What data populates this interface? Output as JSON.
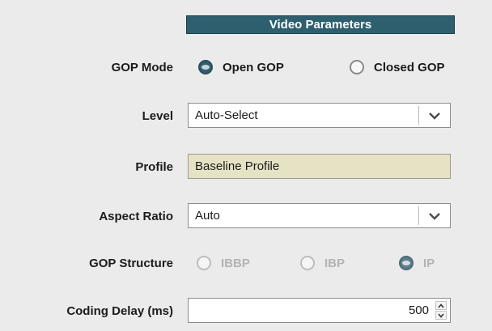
{
  "header": {
    "title": "Video Parameters"
  },
  "gop_mode": {
    "label": "GOP Mode",
    "options": [
      {
        "label": "Open GOP",
        "checked": true
      },
      {
        "label": "Closed GOP",
        "checked": false
      }
    ]
  },
  "level": {
    "label": "Level",
    "value": "Auto-Select",
    "icon": "chevron-down-icon"
  },
  "profile": {
    "label": "Profile",
    "value": "Baseline Profile"
  },
  "aspect_ratio": {
    "label": "Aspect Ratio",
    "value": "Auto",
    "icon": "chevron-down-icon"
  },
  "gop_structure": {
    "label": "GOP Structure",
    "disabled": true,
    "options": [
      {
        "label": "IBBP",
        "checked": false
      },
      {
        "label": "IBP",
        "checked": false
      },
      {
        "label": "IP",
        "checked": true
      }
    ]
  },
  "coding_delay": {
    "label": "Coding Delay (ms)",
    "value": "500",
    "icons": [
      "spin-up-icon",
      "spin-down-icon"
    ]
  },
  "colors": {
    "header_bg": "#2e5f6f",
    "panel_bg": "#ebebeb",
    "readonly_bg": "#e6e3c4"
  }
}
